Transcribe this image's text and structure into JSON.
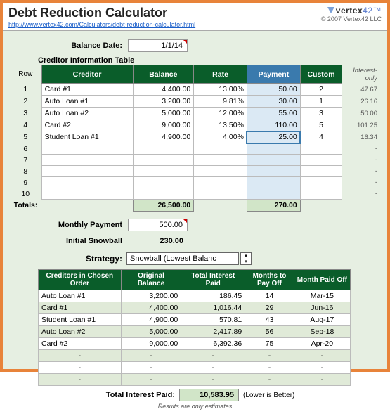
{
  "header": {
    "title": "Debt Reduction Calculator",
    "url": "http://www.vertex42.com/Calculators/debt-reduction-calculator.html",
    "logo_brand": "vertex",
    "logo_num": "42",
    "copyright": "© 2007 Vertex42 LLC"
  },
  "balance_date": {
    "label": "Balance Date:",
    "value": "1/1/14"
  },
  "table_title": "Creditor Information Table",
  "row_label": "Row",
  "interest_only_label": "Interest-only",
  "columns": {
    "creditor": "Creditor",
    "balance": "Balance",
    "rate": "Rate",
    "payment": "Payment",
    "custom": "Custom"
  },
  "creditors": [
    {
      "row": "1",
      "name": "Card #1",
      "balance": "4,400.00",
      "rate": "13.00%",
      "payment": "50.00",
      "custom": "2",
      "interest": "47.67"
    },
    {
      "row": "2",
      "name": "Auto Loan #1",
      "balance": "3,200.00",
      "rate": "9.81%",
      "payment": "30.00",
      "custom": "1",
      "interest": "26.16"
    },
    {
      "row": "3",
      "name": "Auto Loan #2",
      "balance": "5,000.00",
      "rate": "12.00%",
      "payment": "55.00",
      "custom": "3",
      "interest": "50.00"
    },
    {
      "row": "4",
      "name": "Card #2",
      "balance": "9,000.00",
      "rate": "13.50%",
      "payment": "110.00",
      "custom": "5",
      "interest": "101.25"
    },
    {
      "row": "5",
      "name": "Student Loan #1",
      "balance": "4,900.00",
      "rate": "4.00%",
      "payment": "25.00",
      "custom": "4",
      "interest": "16.34"
    }
  ],
  "empty_rows": [
    "6",
    "7",
    "8",
    "9",
    "10"
  ],
  "totals": {
    "label": "Totals:",
    "balance": "26,500.00",
    "payment": "270.00"
  },
  "monthly_payment": {
    "label": "Monthly Payment",
    "value": "500.00"
  },
  "initial_snowball": {
    "label": "Initial Snowball",
    "value": "230.00"
  },
  "strategy": {
    "label": "Strategy:",
    "selected": "Snowball (Lowest Balanc"
  },
  "results_cols": {
    "creditor": "Creditors in Chosen Order",
    "balance": "Original Balance",
    "interest": "Total Interest Paid",
    "months": "Months to Pay Off",
    "paidoff": "Month Paid Off"
  },
  "results": [
    {
      "name": "Auto Loan #1",
      "balance": "3,200.00",
      "interest": "186.45",
      "months": "14",
      "paidoff": "Mar-15"
    },
    {
      "name": "Card #1",
      "balance": "4,400.00",
      "interest": "1,016.44",
      "months": "29",
      "paidoff": "Jun-16"
    },
    {
      "name": "Student Loan #1",
      "balance": "4,900.00",
      "interest": "570.81",
      "months": "43",
      "paidoff": "Aug-17"
    },
    {
      "name": "Auto Loan #2",
      "balance": "5,000.00",
      "interest": "2,417.89",
      "months": "56",
      "paidoff": "Sep-18"
    },
    {
      "name": "Card #2",
      "balance": "9,000.00",
      "interest": "6,392.36",
      "months": "75",
      "paidoff": "Apr-20"
    }
  ],
  "total_interest": {
    "label": "Total Interest Paid:",
    "value": "10,583.95",
    "note": "(Lower is Better)"
  },
  "estimates": "Results are only estimates"
}
